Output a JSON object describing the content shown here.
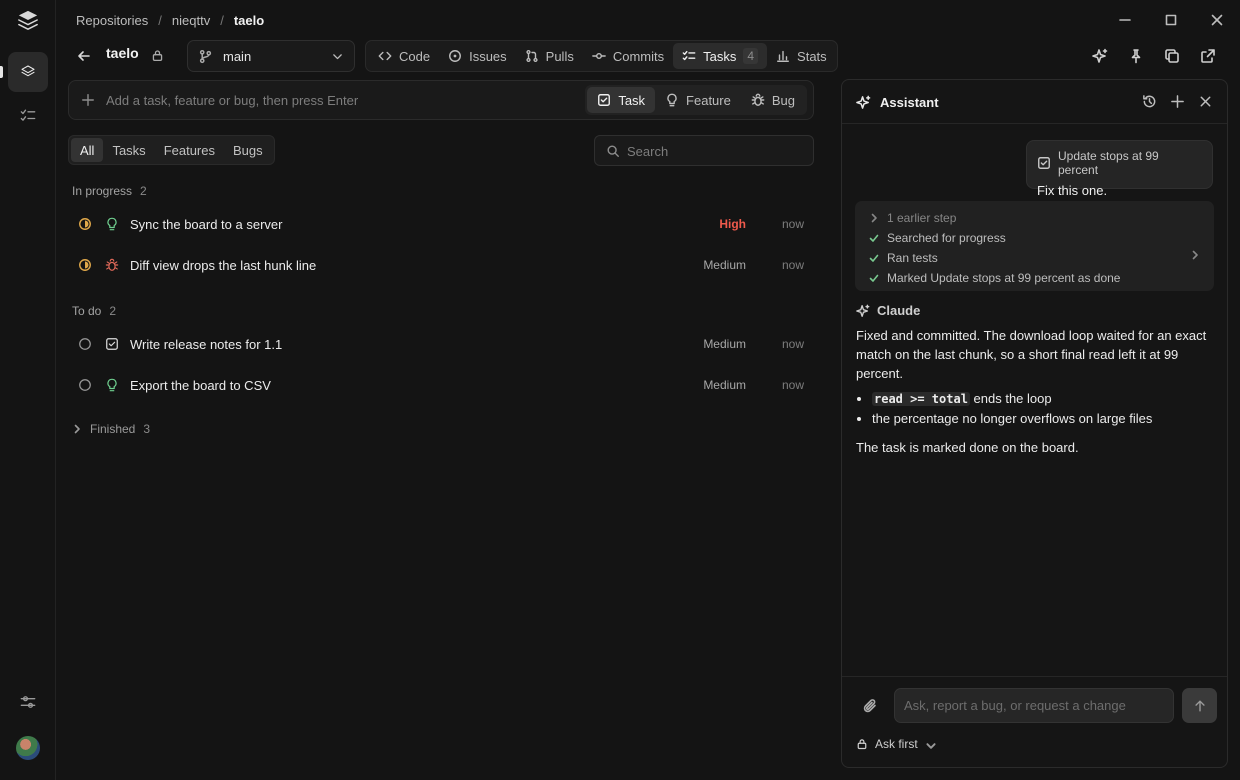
{
  "breadcrumb": {
    "items": [
      "Repositories",
      "nieqttv",
      "taelo"
    ]
  },
  "repo": {
    "name": "taelo",
    "branch": "main"
  },
  "tabs": [
    {
      "label": "Code",
      "icon": "code-icon"
    },
    {
      "label": "Issues",
      "icon": "issue-circle-icon"
    },
    {
      "label": "Pulls",
      "icon": "pull-request-icon"
    },
    {
      "label": "Commits",
      "icon": "commit-icon"
    },
    {
      "label": "Tasks",
      "icon": "checklist-icon",
      "count": "4",
      "active": true
    },
    {
      "label": "Stats",
      "icon": "bar-chart-icon"
    }
  ],
  "add_bar": {
    "placeholder": "Add a task, feature or bug, then press Enter",
    "types": [
      "Task",
      "Feature",
      "Bug"
    ],
    "active_type": "Task"
  },
  "filter": {
    "options": [
      "All",
      "Tasks",
      "Features",
      "Bugs"
    ],
    "active": "All"
  },
  "search": {
    "placeholder": "Search"
  },
  "groups": {
    "in_progress": {
      "label": "In progress",
      "count": "2"
    },
    "todo": {
      "label": "To do",
      "count": "2"
    },
    "finished": {
      "label": "Finished",
      "count": "3"
    }
  },
  "tasks": [
    {
      "title": "Sync the board to a server",
      "type": "feature",
      "status": "in-progress",
      "priority": "High",
      "time": "now"
    },
    {
      "title": "Diff view drops the last hunk line",
      "type": "bug",
      "status": "in-progress",
      "priority": "Medium",
      "time": "now"
    },
    {
      "title": "Write release notes for 1.1",
      "type": "task",
      "status": "todo",
      "priority": "Medium",
      "time": "now"
    },
    {
      "title": "Export the board to CSV",
      "type": "feature",
      "status": "todo",
      "priority": "Medium",
      "time": "now"
    }
  ],
  "assistant": {
    "title": "Assistant",
    "user_message": {
      "attachment": "Update stops at 99 percent",
      "text": "Fix this one."
    },
    "steps": [
      "1 earlier step",
      "Searched for progress",
      "Ran tests",
      "Marked Update stops at 99 percent as done"
    ],
    "author": "Claude",
    "reply": {
      "p1": "Fixed and committed. The download loop waited for an exact match on the last chunk, so a short final read left it at 99 percent.",
      "b1_code": "read >= total",
      "b1_rest": " ends the loop",
      "b2": "the percentage no longer overflows on large files",
      "p2": "The task is marked done on the board."
    },
    "composer_placeholder": "Ask, report a bug, or request a change",
    "mode": "Ask first"
  },
  "colors": {
    "accent_high": "#ef5a4c",
    "in_progress": "#e0a84a",
    "bug": "#e26a5a",
    "feature": "#6fcf8f",
    "background": "#141414"
  }
}
